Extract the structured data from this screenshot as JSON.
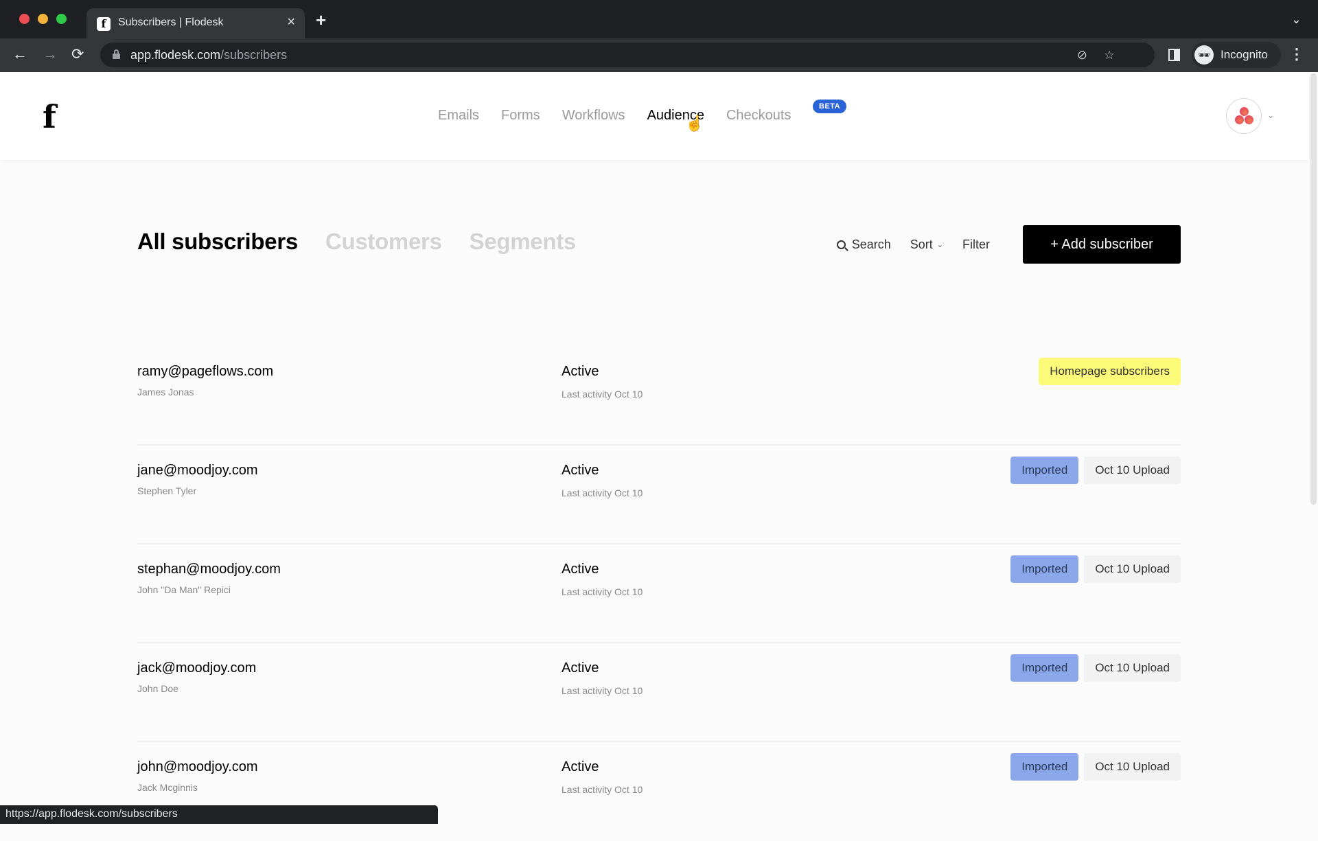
{
  "browser": {
    "tab_title": "Subscribers | Flodesk",
    "favicon_glyph": "f",
    "close_glyph": "×",
    "newtab_glyph": "+",
    "tabmenu_glyph": "⌄",
    "back_glyph": "←",
    "forward_glyph": "→",
    "reload_glyph": "⟳",
    "url_host": "app.flodesk.com",
    "url_path": "/subscribers",
    "eye_glyph": "⊘",
    "star_glyph": "☆",
    "incognito_glyph": "🕶",
    "incognito_label": "Incognito",
    "menu_glyph": "⋮",
    "status_url": "https://app.flodesk.com/subscribers"
  },
  "header": {
    "logo_glyph": "f",
    "nav": [
      {
        "label": "Emails",
        "active": false
      },
      {
        "label": "Forms",
        "active": false
      },
      {
        "label": "Workflows",
        "active": false
      },
      {
        "label": "Audience",
        "active": true
      },
      {
        "label": "Checkouts",
        "active": false
      }
    ],
    "beta_label": "BETA",
    "cursor_glyph": "☝",
    "account_chevron": "⌄"
  },
  "subtabs": [
    {
      "label": "All subscribers",
      "active": true
    },
    {
      "label": "Customers",
      "active": false
    },
    {
      "label": "Segments",
      "active": false
    }
  ],
  "actions": {
    "search_label": "Search",
    "sort_label": "Sort",
    "sort_chevron": "⌄",
    "filter_label": "Filter",
    "add_label": "+ Add subscriber"
  },
  "subscribers": [
    {
      "email": "ramy@pageflows.com",
      "name": "James Jonas",
      "status": "Active",
      "activity": "Last activity Oct 10",
      "tags": [
        {
          "label": "Homepage subscribers",
          "style": "yellow"
        }
      ]
    },
    {
      "email": "jane@moodjoy.com",
      "name": "Stephen Tyler",
      "status": "Active",
      "activity": "Last activity Oct 10",
      "tags": [
        {
          "label": "Imported",
          "style": "blue"
        },
        {
          "label": "Oct 10 Upload",
          "style": "gray"
        }
      ]
    },
    {
      "email": "stephan@moodjoy.com",
      "name": "John \"Da Man\" Repici",
      "status": "Active",
      "activity": "Last activity Oct 10",
      "tags": [
        {
          "label": "Imported",
          "style": "blue"
        },
        {
          "label": "Oct 10 Upload",
          "style": "gray"
        }
      ]
    },
    {
      "email": "jack@moodjoy.com",
      "name": "John Doe",
      "status": "Active",
      "activity": "Last activity Oct 10",
      "tags": [
        {
          "label": "Imported",
          "style": "blue"
        },
        {
          "label": "Oct 10 Upload",
          "style": "gray"
        }
      ]
    },
    {
      "email": "john@moodjoy.com",
      "name": "Jack Mcginnis",
      "status": "Active",
      "activity": "Last activity Oct 10",
      "tags": [
        {
          "label": "Imported",
          "style": "blue"
        },
        {
          "label": "Oct 10 Upload",
          "style": "gray"
        }
      ]
    }
  ],
  "colors": {
    "beta_badge": "#2b62d8",
    "tag_yellow": "#fcfa78",
    "tag_blue": "#8ca6ea",
    "tag_gray": "#f2f2f2",
    "primary_button": "#000000"
  }
}
